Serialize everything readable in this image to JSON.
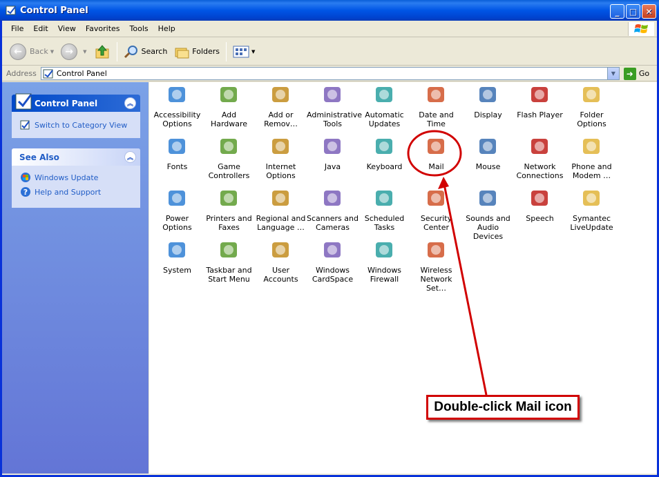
{
  "window": {
    "title": "Control Panel",
    "buttons": {
      "minimize": "_",
      "maximize": "□",
      "close": "✕"
    }
  },
  "menubar": {
    "items": [
      "File",
      "Edit",
      "View",
      "Favorites",
      "Tools",
      "Help"
    ]
  },
  "toolbar": {
    "back": "Back",
    "forward": "",
    "search": "Search",
    "folders": "Folders"
  },
  "address": {
    "label": "Address",
    "value": "Control Panel",
    "go": "Go"
  },
  "sidebar": {
    "control_panel": {
      "title": "Control Panel",
      "links": [
        "Switch to Category View"
      ]
    },
    "see_also": {
      "title": "See Also",
      "links": [
        "Windows Update",
        "Help and Support"
      ]
    }
  },
  "items": [
    {
      "line1": "Accessibility",
      "line2": "Options",
      "icon": "accessibility-icon"
    },
    {
      "line1": "Add Hardware",
      "line2": "",
      "icon": "add-hardware-icon"
    },
    {
      "line1": "Add or",
      "line2": "Remov…",
      "icon": "add-remove-programs-icon"
    },
    {
      "line1": "Administrative",
      "line2": "Tools",
      "icon": "admin-tools-icon"
    },
    {
      "line1": "Automatic",
      "line2": "Updates",
      "icon": "automatic-updates-icon"
    },
    {
      "line1": "Date and Time",
      "line2": "",
      "icon": "date-time-icon"
    },
    {
      "line1": "Display",
      "line2": "",
      "icon": "display-icon"
    },
    {
      "line1": "Flash Player",
      "line2": "",
      "icon": "flash-player-icon"
    },
    {
      "line1": "Folder Options",
      "line2": "",
      "icon": "folder-options-icon"
    },
    {
      "line1": "Fonts",
      "line2": "",
      "icon": "fonts-icon"
    },
    {
      "line1": "Game",
      "line2": "Controllers",
      "icon": "game-controllers-icon"
    },
    {
      "line1": "Internet",
      "line2": "Options",
      "icon": "internet-options-icon"
    },
    {
      "line1": "Java",
      "line2": "",
      "icon": "java-icon"
    },
    {
      "line1": "Keyboard",
      "line2": "",
      "icon": "keyboard-icon"
    },
    {
      "line1": "Mail",
      "line2": "",
      "icon": "mail-icon"
    },
    {
      "line1": "Mouse",
      "line2": "",
      "icon": "mouse-icon"
    },
    {
      "line1": "Network",
      "line2": "Connections",
      "icon": "network-connections-icon"
    },
    {
      "line1": "Phone and",
      "line2": "Modem …",
      "icon": "phone-modem-icon"
    },
    {
      "line1": "Power Options",
      "line2": "",
      "icon": "power-options-icon"
    },
    {
      "line1": "Printers and",
      "line2": "Faxes",
      "icon": "printers-faxes-icon"
    },
    {
      "line1": "Regional and",
      "line2": "Language …",
      "icon": "regional-language-icon"
    },
    {
      "line1": "Scanners and",
      "line2": "Cameras",
      "icon": "scanners-cameras-icon"
    },
    {
      "line1": "Scheduled",
      "line2": "Tasks",
      "icon": "scheduled-tasks-icon"
    },
    {
      "line1": "Security",
      "line2": "Center",
      "icon": "security-center-icon"
    },
    {
      "line1": "Sounds and",
      "line2": "Audio Devices",
      "icon": "sounds-audio-icon"
    },
    {
      "line1": "Speech",
      "line2": "",
      "icon": "speech-icon"
    },
    {
      "line1": "Symantec",
      "line2": "LiveUpdate",
      "icon": "symantec-liveupdate-icon"
    },
    {
      "line1": "System",
      "line2": "",
      "icon": "system-icon"
    },
    {
      "line1": "Taskbar and",
      "line2": "Start Menu",
      "icon": "taskbar-start-menu-icon"
    },
    {
      "line1": "User Accounts",
      "line2": "",
      "icon": "user-accounts-icon"
    },
    {
      "line1": "Windows",
      "line2": "CardSpace",
      "icon": "windows-cardspace-icon"
    },
    {
      "line1": "Windows",
      "line2": "Firewall",
      "icon": "windows-firewall-icon"
    },
    {
      "line1": "Wireless",
      "line2": "Network Set…",
      "icon": "wireless-network-icon"
    }
  ],
  "annotation": {
    "text": "Double-click Mail icon"
  },
  "colors": {
    "title_blue": "#0055e5",
    "sidebar_blue": "#6375d6",
    "annotation_red": "#d10000"
  }
}
